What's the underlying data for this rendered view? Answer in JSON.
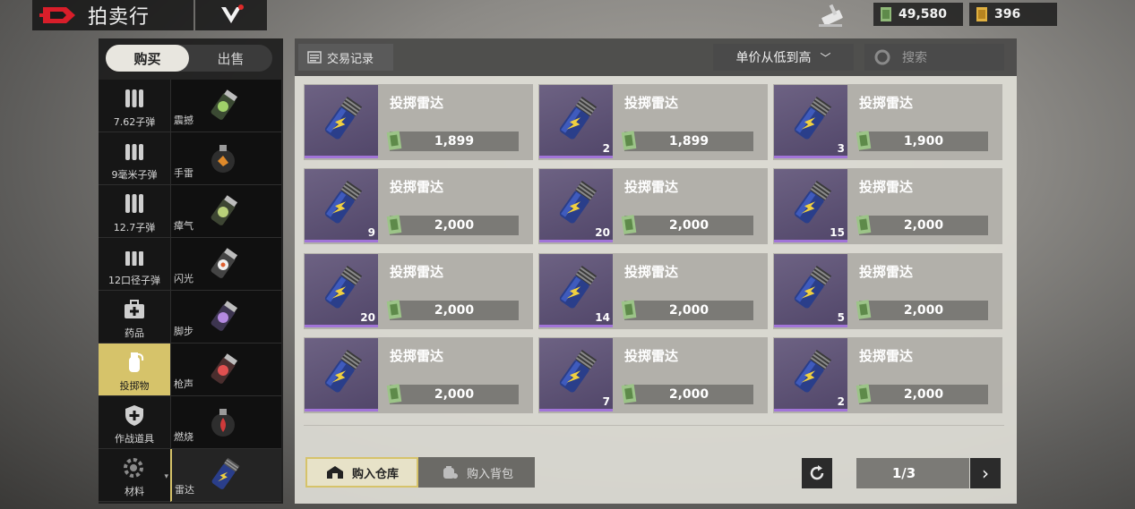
{
  "header": {
    "title": "拍卖行",
    "cash": "49,580",
    "gold": "396"
  },
  "mode_toggle": {
    "buy": "购买",
    "sell": "出售",
    "selected": "购买"
  },
  "categories": [
    {
      "label": "7.62子弹",
      "icon": "rifle-ammo-icon"
    },
    {
      "label": "9毫米子弹",
      "icon": "pistol-ammo-icon"
    },
    {
      "label": "12.7子弹",
      "icon": "heavy-ammo-icon"
    },
    {
      "label": "12口径子弹",
      "icon": "shotgun-ammo-icon"
    },
    {
      "label": "药品",
      "icon": "medkit-icon"
    },
    {
      "label": "投掷物",
      "icon": "grenade-icon",
      "active": true
    },
    {
      "label": "作战道具",
      "icon": "shield-plus-icon"
    },
    {
      "label": "材料",
      "icon": "gear-wrench-icon"
    }
  ],
  "subcategories": [
    {
      "label": "震撼",
      "color": "#9fd06a"
    },
    {
      "label": "手雷",
      "color": "#e08a2a"
    },
    {
      "label": "瘴气",
      "color": "#b9d07a"
    },
    {
      "label": "闪光",
      "color": "#e0e0e0"
    },
    {
      "label": "脚步",
      "color": "#b48ae0"
    },
    {
      "label": "枪声",
      "color": "#e05050"
    },
    {
      "label": "燃烧",
      "color": "#d03a3a"
    },
    {
      "label": "雷达",
      "color": "#4f6fe0",
      "active": true
    }
  ],
  "toolbar": {
    "trade_record": "交易记录",
    "sort": "单价从低到高",
    "search_placeholder": "搜索"
  },
  "listings": [
    {
      "name": "投掷雷达",
      "qty": "",
      "price": "1,899"
    },
    {
      "name": "投掷雷达",
      "qty": "2",
      "price": "1,899"
    },
    {
      "name": "投掷雷达",
      "qty": "3",
      "price": "1,900"
    },
    {
      "name": "投掷雷达",
      "qty": "9",
      "price": "2,000"
    },
    {
      "name": "投掷雷达",
      "qty": "20",
      "price": "2,000"
    },
    {
      "name": "投掷雷达",
      "qty": "15",
      "price": "2,000"
    },
    {
      "name": "投掷雷达",
      "qty": "20",
      "price": "2,000"
    },
    {
      "name": "投掷雷达",
      "qty": "14",
      "price": "2,000"
    },
    {
      "name": "投掷雷达",
      "qty": "5",
      "price": "2,000"
    },
    {
      "name": "投掷雷达",
      "qty": "",
      "price": "2,000"
    },
    {
      "name": "投掷雷达",
      "qty": "7",
      "price": "2,000"
    },
    {
      "name": "投掷雷达",
      "qty": "2",
      "price": "2,000"
    }
  ],
  "footer": {
    "buy_warehouse": "购入仓库",
    "buy_backpack": "购入背包",
    "page": "1/3"
  },
  "colors": {
    "accent": "#d6c36a",
    "rarity_purple": "#a174d8",
    "panel_light": "#e0ded7"
  }
}
